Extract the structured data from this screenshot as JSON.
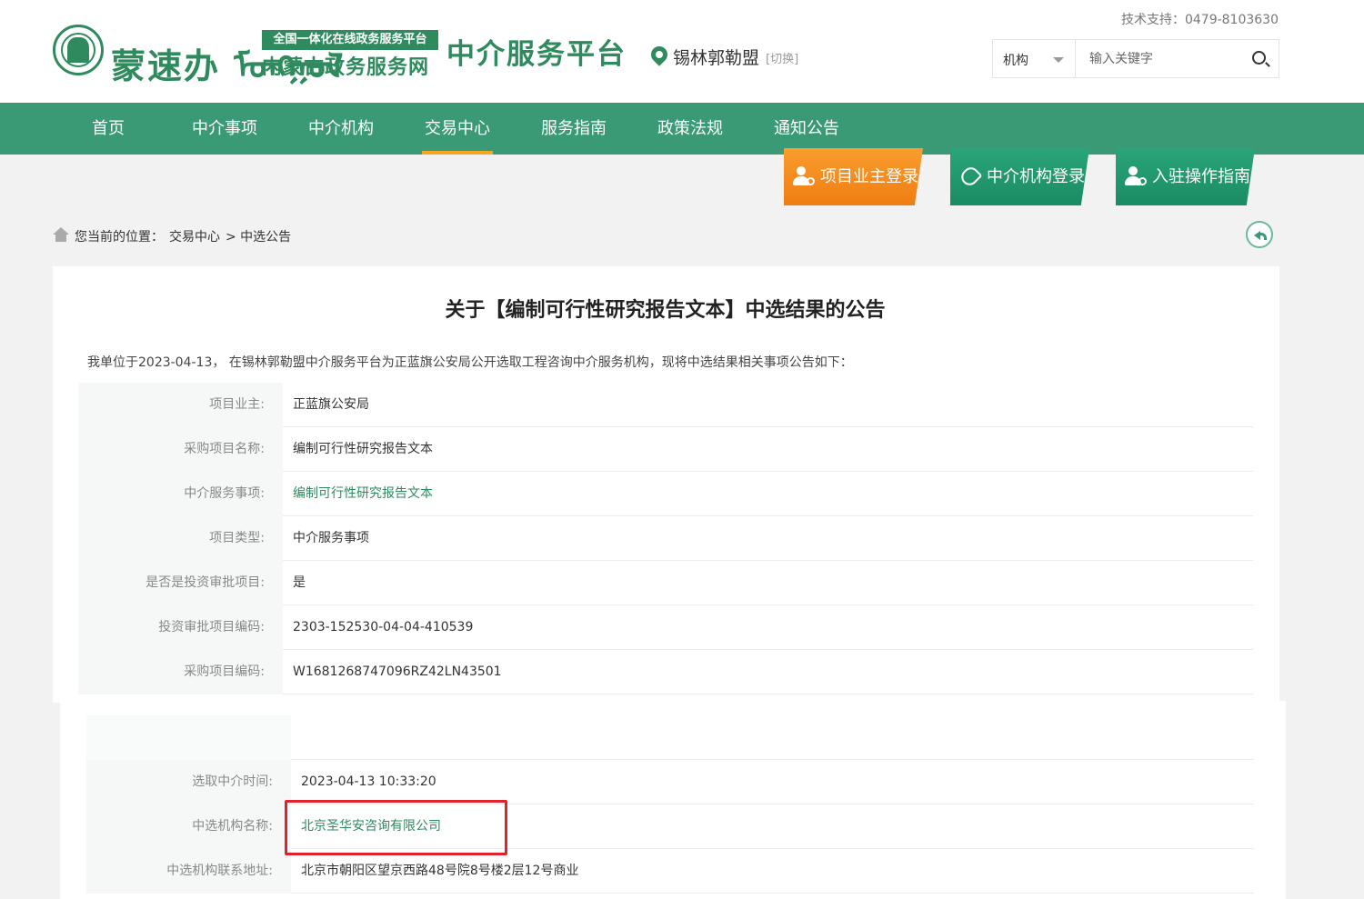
{
  "header": {
    "logo_script": "蒙速办 ᠮᠣᠩᠭᠣᠯ",
    "logo_tag": "全国一体化在线政务服务平台",
    "logo_sub": "内蒙古政务服务网",
    "platform_title": "中介服务平台",
    "region": "锡林郭勒盟",
    "switch_label": "[切换]",
    "tech_support": "技术支持：0479-8103630",
    "search": {
      "category": "机构",
      "placeholder": "输入关键字"
    }
  },
  "nav": {
    "items": [
      {
        "label": "首页"
      },
      {
        "label": "中介事项"
      },
      {
        "label": "中介机构"
      },
      {
        "label": "交易中心"
      },
      {
        "label": "服务指南"
      },
      {
        "label": "政策法规"
      },
      {
        "label": "通知公告"
      }
    ],
    "active": "交易中心"
  },
  "quick_buttons": {
    "owner_login": "项目业主登录",
    "agency_login": "中介机构登录",
    "guide": "入驻操作指南"
  },
  "breadcrumb": {
    "prefix": "您当前的位置：",
    "level1": "交易中心",
    "level2": "> 中选公告"
  },
  "notice": {
    "title": "关于【编制可行性研究报告文本】中选结果的公告",
    "intro": "我单位于2023-04-13， 在锡林郭勒盟中介服务平台为正蓝旗公安局公开选取工程咨询中介服务机构，现将中选结果相关事项公告如下：",
    "rows": [
      {
        "label": "项目业主:",
        "value": "正蓝旗公安局"
      },
      {
        "label": "采购项目名称:",
        "value": "编制可行性研究报告文本"
      },
      {
        "label": "中介服务事项:",
        "value": "编制可行性研究报告文本"
      },
      {
        "label": "项目类型:",
        "value": "中介服务事项"
      },
      {
        "label": "是否是投资审批项目:",
        "value": "是"
      },
      {
        "label": "投资审批项目编码:",
        "value": "2303-152530-04-04-410539"
      },
      {
        "label": "采购项目编码:",
        "value": "W1681268747096RZ42LN43501"
      }
    ],
    "rows2": [
      {
        "label": "选取中介时间:",
        "value": "2023-04-13 10:33:20"
      },
      {
        "label": "中选机构名称:",
        "value": "北京圣华安咨询有限公司"
      },
      {
        "label": "中选机构联系地址:",
        "value": "北京市朝阳区望京西路48号院8号楼2层12号商业"
      }
    ]
  },
  "colors": {
    "brand_green": "#3b9a76",
    "accent_orange": "#f5a623",
    "highlight_red": "#e0222c"
  }
}
